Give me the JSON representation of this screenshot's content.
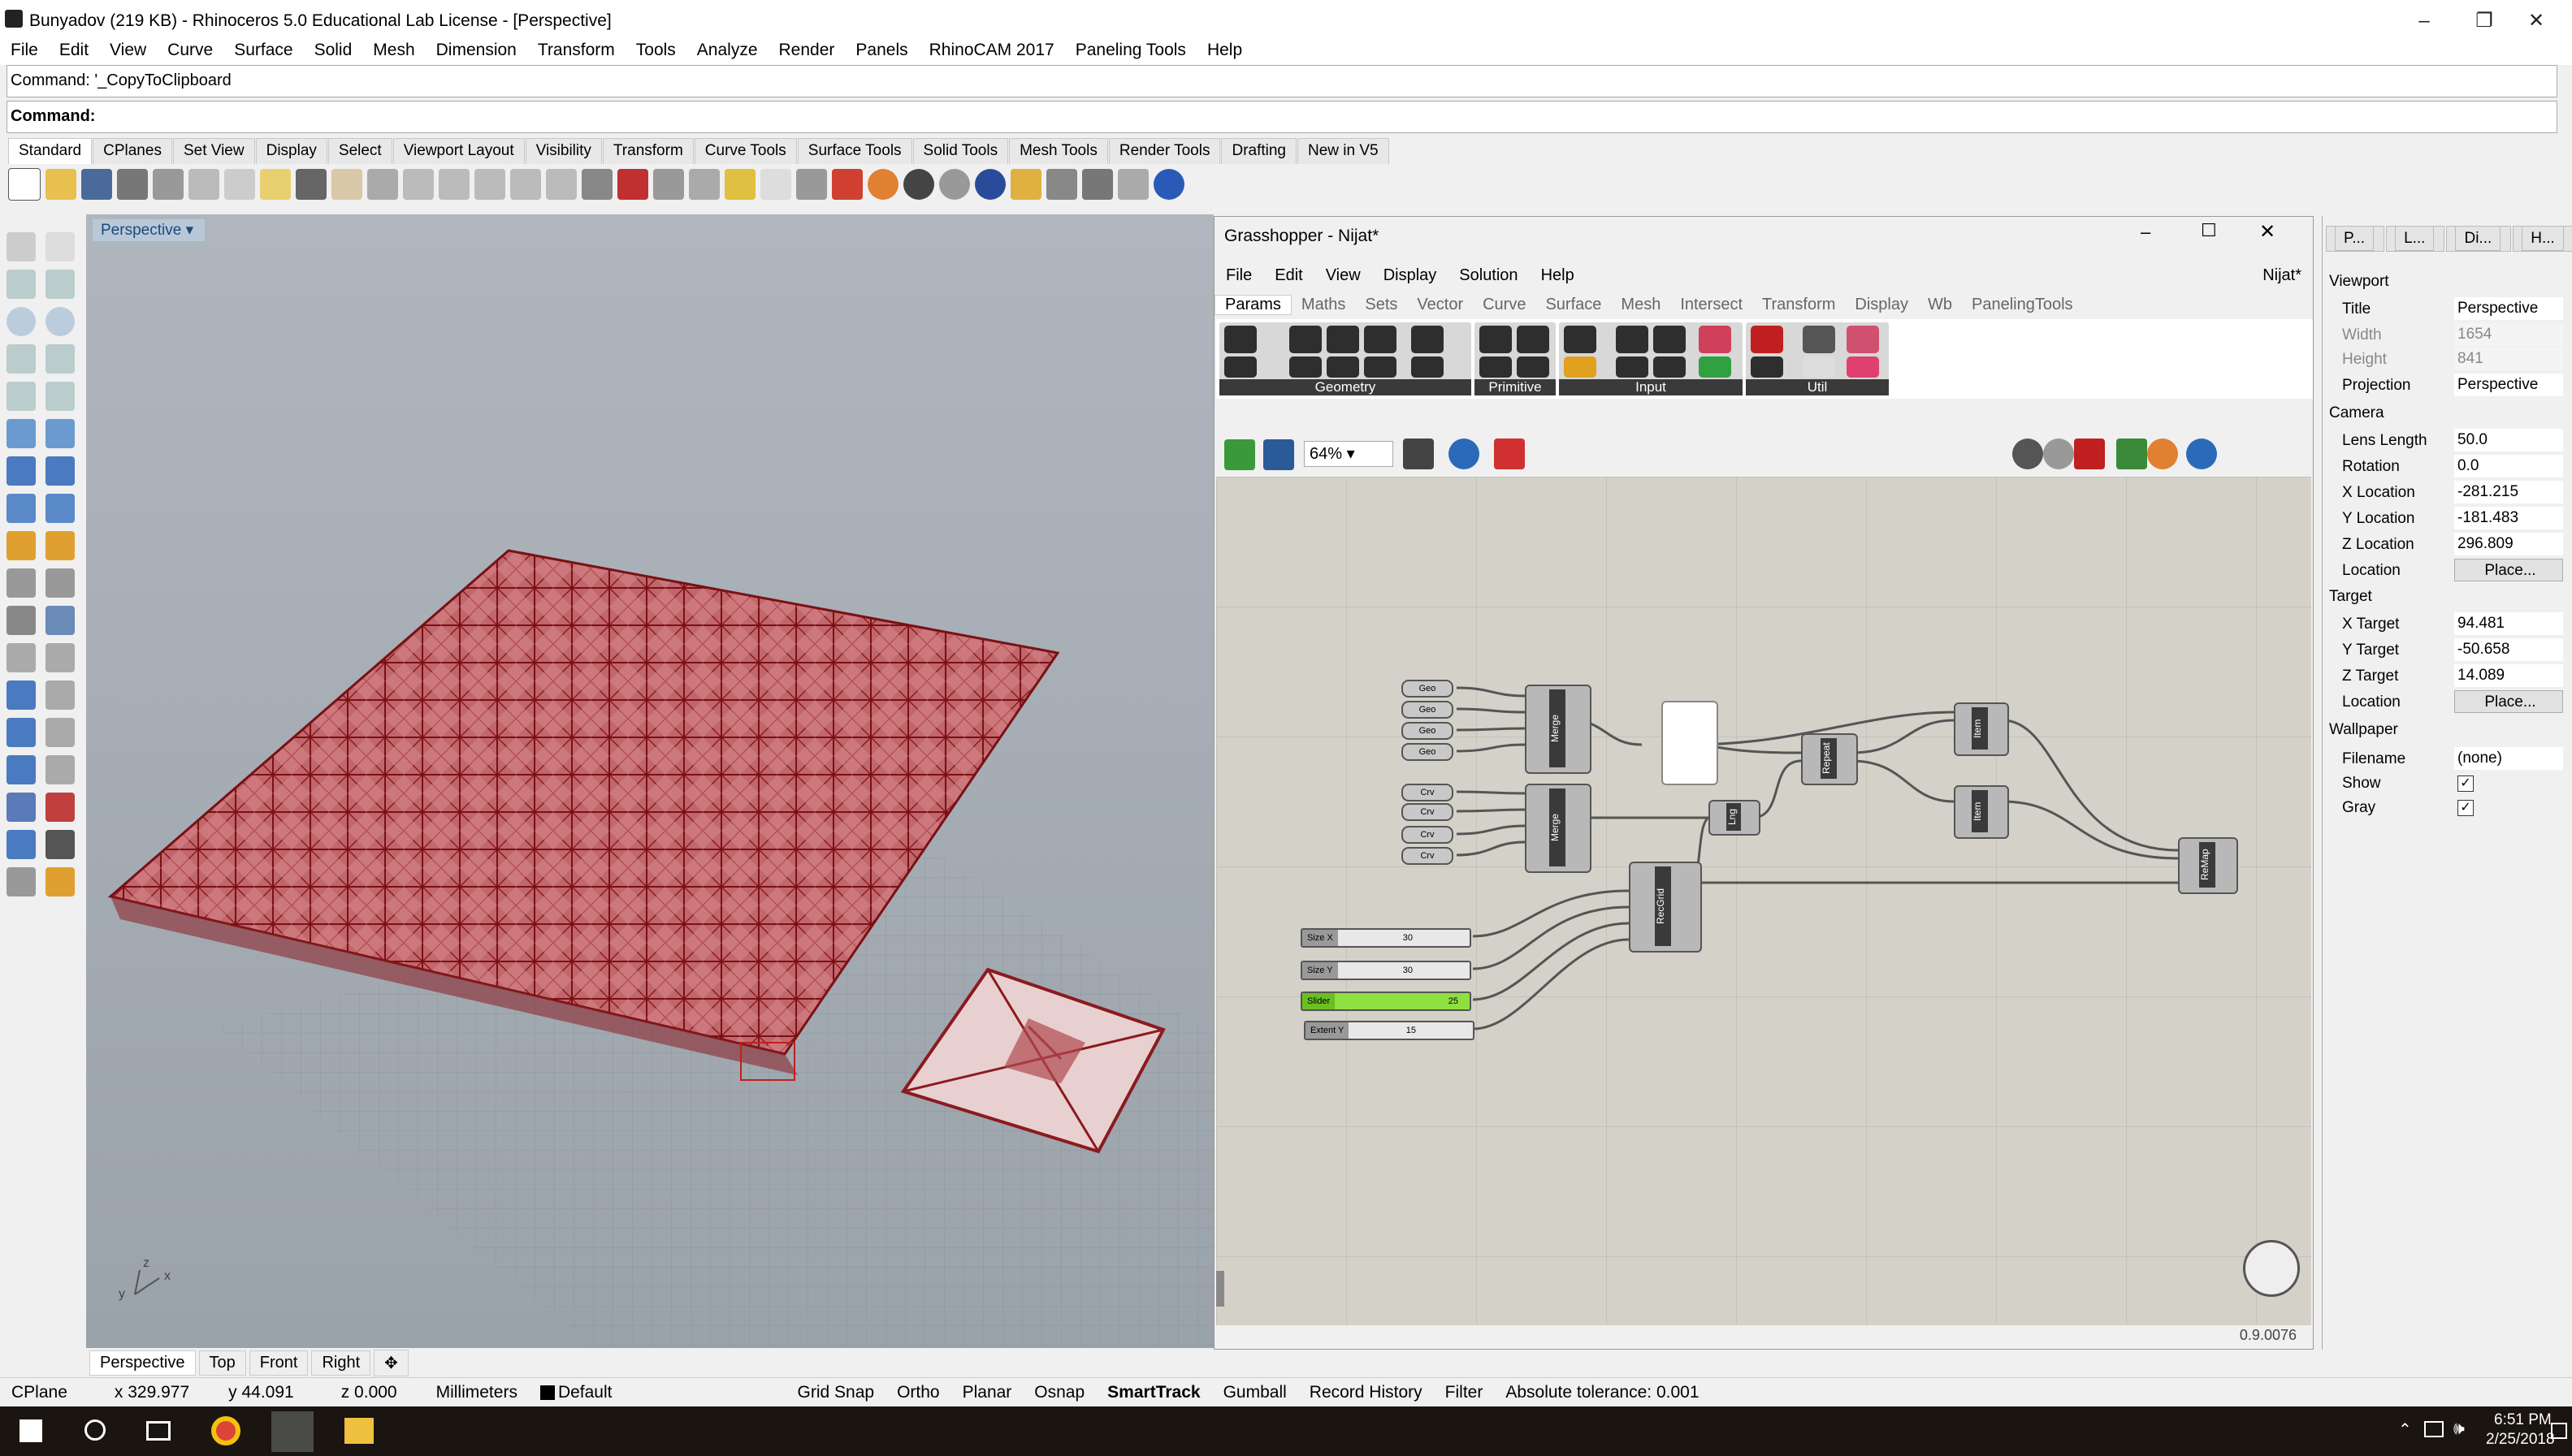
{
  "window": {
    "title": "Bunyadov (219 KB) - Rhinoceros 5.0 Educational Lab License - [Perspective]"
  },
  "menu": [
    "File",
    "Edit",
    "View",
    "Curve",
    "Surface",
    "Solid",
    "Mesh",
    "Dimension",
    "Transform",
    "Tools",
    "Analyze",
    "Render",
    "Panels",
    "RhinoCAM 2017",
    "Paneling Tools",
    "Help"
  ],
  "command": {
    "history": "Command: '_CopyToClipboard",
    "prompt": "Command:"
  },
  "toolbar_tabs": [
    "Standard",
    "CPlanes",
    "Set View",
    "Display",
    "Select",
    "Viewport Layout",
    "Visibility",
    "Transform",
    "Curve Tools",
    "Surface Tools",
    "Solid Tools",
    "Mesh Tools",
    "Render Tools",
    "Drafting",
    "New in V5"
  ],
  "viewport": {
    "label": "Perspective",
    "tabs": [
      "Perspective",
      "Top",
      "Front",
      "Right"
    ]
  },
  "status": {
    "cplane": "CPlane",
    "x": "x 329.977",
    "y": "y 44.091",
    "z": "z 0.000",
    "units": "Millimeters",
    "layer": "Default",
    "items": [
      "Grid Snap",
      "Ortho",
      "Planar",
      "Osnap",
      "SmartTrack",
      "Gumball",
      "Record History",
      "Filter"
    ],
    "tolerance": "Absolute tolerance: 0.001"
  },
  "taskbar": {
    "time": "6:51 PM",
    "date": "2/25/2018"
  },
  "grasshopper": {
    "title": "Grasshopper - Nijat*",
    "doc": "Nijat*",
    "menu": [
      "File",
      "Edit",
      "View",
      "Display",
      "Solution",
      "Help"
    ],
    "tabs": [
      "Params",
      "Maths",
      "Sets",
      "Vector",
      "Curve",
      "Surface",
      "Mesh",
      "Intersect",
      "Transform",
      "Display",
      "Wb",
      "PanelingTools"
    ],
    "groups": [
      "Geometry",
      "Primitive",
      "Input",
      "Util"
    ],
    "zoom": "64%",
    "version": "0.9.0076",
    "nodes": {
      "merge": "Merge",
      "repeat": "Repeat",
      "item": "Item",
      "lng": "Lng",
      "rectgrid": "RecGrid",
      "remap": "ReMap"
    },
    "params": {
      "geo": "Geo",
      "crv": "Crv"
    },
    "sliders": [
      {
        "name": "Size X",
        "value": "30"
      },
      {
        "name": "Size Y",
        "value": "30"
      },
      {
        "name": "Slider",
        "value": "25"
      },
      {
        "name": "Extent Y",
        "value": "15"
      }
    ]
  },
  "properties": {
    "tabs": [
      "P...",
      "L...",
      "Di...",
      "H..."
    ],
    "viewport_header": "Viewport",
    "title_k": "Title",
    "title_v": "Perspective",
    "width_k": "Width",
    "width_v": "1654",
    "height_k": "Height",
    "height_v": "841",
    "proj_k": "Projection",
    "proj_v": "Perspective",
    "camera_header": "Camera",
    "lens_k": "Lens Length",
    "lens_v": "50.0",
    "rot_k": "Rotation",
    "rot_v": "0.0",
    "xl_k": "X Location",
    "xl_v": "-281.215",
    "yl_k": "Y Location",
    "yl_v": "-181.483",
    "zl_k": "Z Location",
    "zl_v": "296.809",
    "loc_k": "Location",
    "loc_v": "Place...",
    "target_header": "Target",
    "xt_k": "X Target",
    "xt_v": "94.481",
    "yt_k": "Y Target",
    "yt_v": "-50.658",
    "zt_k": "Z Target",
    "zt_v": "14.089",
    "tloc_k": "Location",
    "tloc_v": "Place...",
    "wall_header": "Wallpaper",
    "file_k": "Filename",
    "file_v": "(none)",
    "show_k": "Show",
    "gray_k": "Gray"
  }
}
